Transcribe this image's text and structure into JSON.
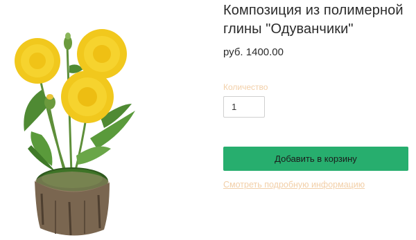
{
  "product": {
    "title_line1": "Композиция из полимерной",
    "title_line2": "глины \"Одуванчики\"",
    "price": "руб. 1400.00",
    "image_alt": "dandelion-composition-photo"
  },
  "quantity": {
    "label": "Количество",
    "value": "1"
  },
  "actions": {
    "add_to_cart_label": "Добавить в корзину",
    "details_link_label": "Смотреть подробную информацию"
  },
  "colors": {
    "accent": "#27ae6e",
    "muted_label": "#f2cfa8"
  }
}
